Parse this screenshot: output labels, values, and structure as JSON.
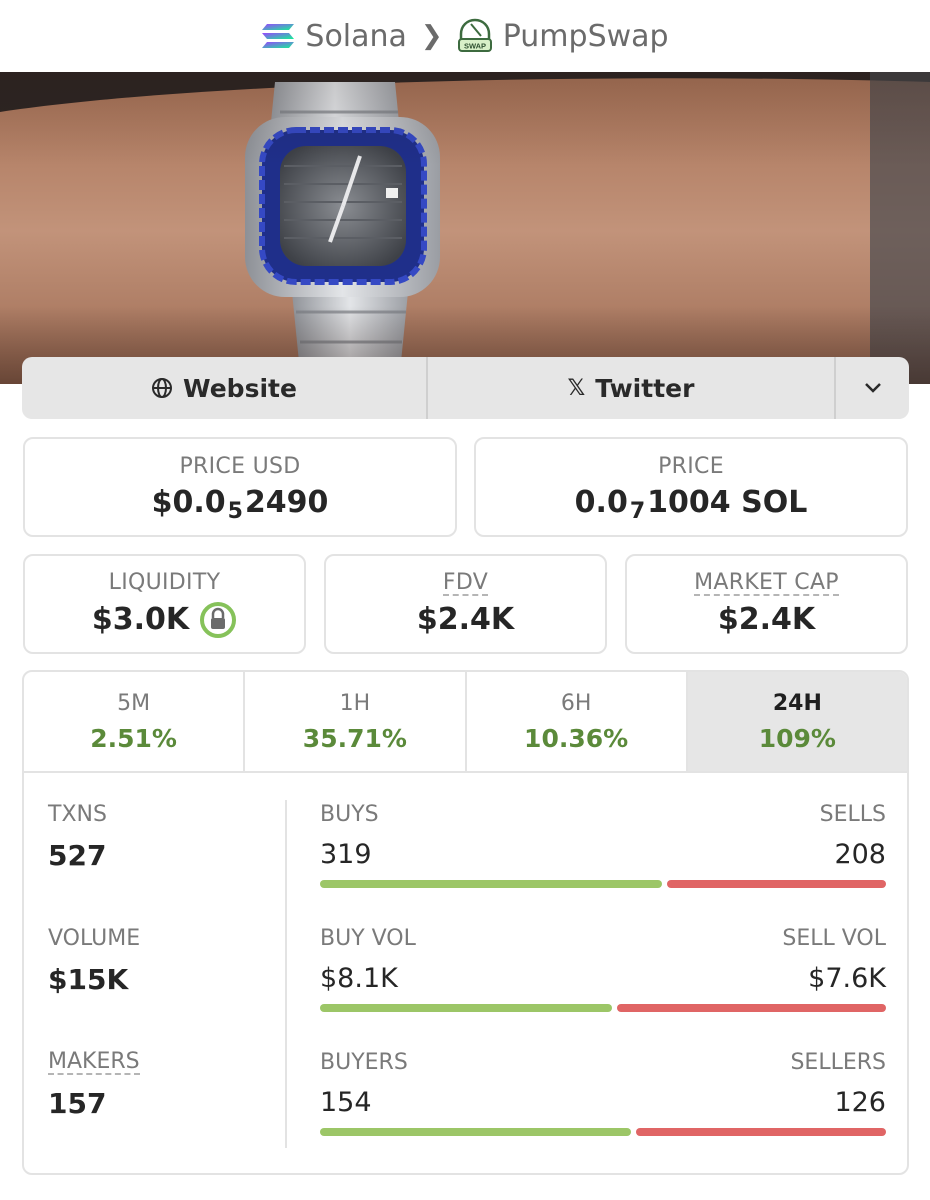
{
  "breadcrumb": {
    "chain": "Solana",
    "separator": ">",
    "dex": "PumpSwap",
    "dex_icon_text": "SWAP"
  },
  "links": {
    "website": "Website",
    "twitter": "Twitter",
    "twitter_glyph": "𝕏",
    "globe_glyph": "🌐",
    "more_glyph": "⌄"
  },
  "price_usd": {
    "label": "PRICE USD",
    "prefix": "$0.0",
    "sub": "5",
    "suffix": "2490"
  },
  "price_native": {
    "label": "PRICE",
    "prefix": "0.0",
    "sub": "7",
    "suffix": "1004 SOL"
  },
  "liquidity": {
    "label": "LIQUIDITY",
    "value": "$3.0K"
  },
  "fdv": {
    "label": "FDV",
    "value": "$2.4K"
  },
  "market_cap": {
    "label": "MARKET CAP",
    "value": "$2.4K"
  },
  "tabs": [
    {
      "label": "5M",
      "value": "2.51%"
    },
    {
      "label": "1H",
      "value": "35.71%"
    },
    {
      "label": "6H",
      "value": "10.36%"
    },
    {
      "label": "24H",
      "value": "109%",
      "selected": true
    }
  ],
  "metrics": {
    "txns": {
      "label": "TXNS",
      "value": "527"
    },
    "volume": {
      "label": "VOLUME",
      "value": "$15K"
    },
    "makers": {
      "label": "MAKERS",
      "value": "157"
    }
  },
  "pairs": {
    "txns": {
      "left_label": "BUYS",
      "left_value": "319",
      "right_label": "SELLS",
      "right_value": "208",
      "buy_fraction": 0.605
    },
    "volume": {
      "left_label": "BUY VOL",
      "left_value": "$8.1K",
      "right_label": "SELL VOL",
      "right_value": "$7.6K",
      "buy_fraction": 0.516
    },
    "makers": {
      "left_label": "BUYERS",
      "left_value": "154",
      "right_label": "SELLERS",
      "right_value": "126",
      "buy_fraction": 0.55
    }
  },
  "colors": {
    "positive": "#5b8a3a",
    "buy_bar": "#9cc667",
    "sell_bar": "#e06565",
    "lock_green": "#86c25a"
  }
}
